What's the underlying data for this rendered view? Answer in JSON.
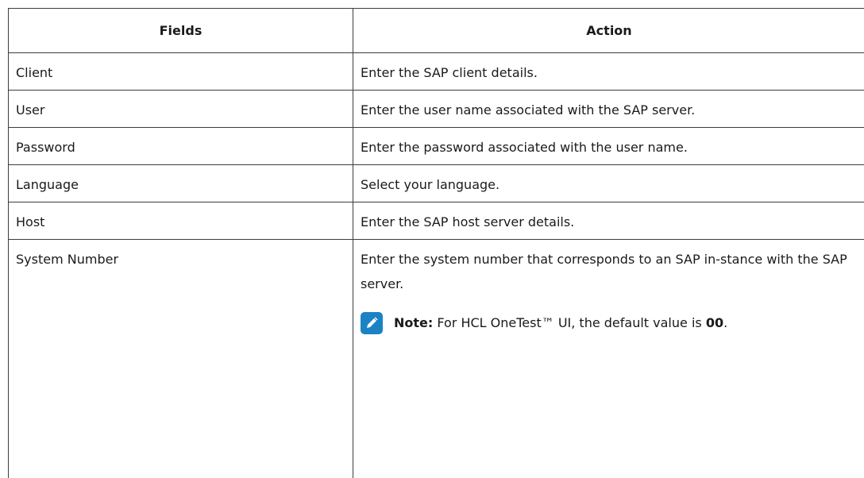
{
  "table": {
    "headers": [
      "Fields",
      "Action"
    ],
    "rows": [
      {
        "field": "Client",
        "action": "Enter the SAP client details."
      },
      {
        "field": "User",
        "action": "Enter the user name associated with the SAP server."
      },
      {
        "field": "Password",
        "action": "Enter the password associated with the user name."
      },
      {
        "field": "Language",
        "action": "Select your language."
      },
      {
        "field": "Host",
        "action": "Enter the SAP host server details."
      },
      {
        "field": "System Number",
        "action": "Enter the system number that corresponds to an SAP in-stance with the SAP server."
      }
    ]
  },
  "note": {
    "label": "Note:",
    "text_before": " For HCL OneTest™ UI, the default value is ",
    "value": "00",
    "text_after": ".",
    "icon": "pencil-note-icon"
  },
  "colors": {
    "border": "#3c3c3c",
    "note_icon_bg": "#1b83c4",
    "text": "#1a1a1a"
  }
}
